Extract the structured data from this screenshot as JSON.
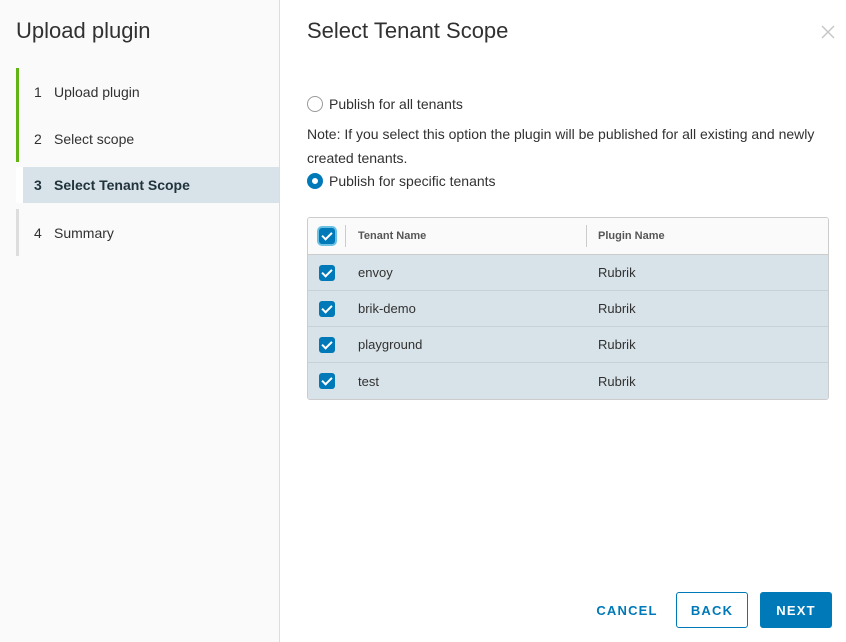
{
  "sidebar": {
    "title": "Upload plugin",
    "steps": [
      {
        "num": "1",
        "label": "Upload plugin"
      },
      {
        "num": "2",
        "label": "Select scope"
      },
      {
        "num": "3",
        "label": "Select Tenant Scope"
      },
      {
        "num": "4",
        "label": "Summary"
      }
    ]
  },
  "main": {
    "title": "Select Tenant Scope",
    "options": {
      "all_tenants": "Publish for all tenants",
      "note": "Note: If you select this option the plugin will be published for all existing and newly created tenants.",
      "specific_tenants": "Publish for specific tenants"
    },
    "grid": {
      "columns": [
        "Tenant Name",
        "Plugin Name"
      ],
      "rows": [
        {
          "tenant": "envoy",
          "plugin": "Rubrik"
        },
        {
          "tenant": "brik-demo",
          "plugin": "Rubrik"
        },
        {
          "tenant": "playground",
          "plugin": "Rubrik"
        },
        {
          "tenant": "test",
          "plugin": "Rubrik"
        }
      ]
    }
  },
  "footer": {
    "cancel": "CANCEL",
    "back": "BACK",
    "next": "NEXT"
  },
  "icons": {
    "close": "close-icon"
  },
  "colors": {
    "accent": "#0079b8",
    "done": "#60b515",
    "selected_row": "#d8e3e9"
  }
}
